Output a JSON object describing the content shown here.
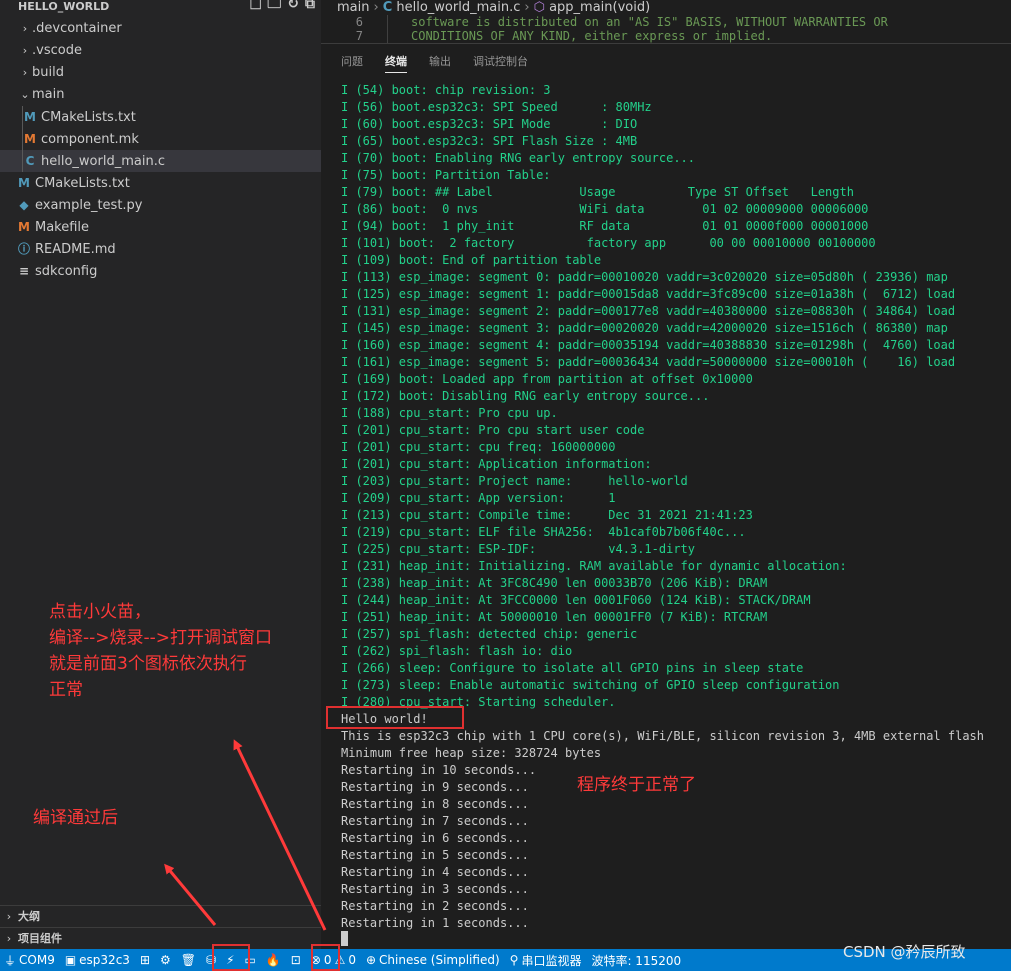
{
  "explorer": {
    "title": "HELLO_WORLD",
    "items": [
      {
        "type": "folder",
        "label": ".devcontainer",
        "expanded": false,
        "depth": 0
      },
      {
        "type": "folder",
        "label": ".vscode",
        "expanded": false,
        "depth": 0
      },
      {
        "type": "folder",
        "label": "build",
        "expanded": false,
        "depth": 0
      },
      {
        "type": "folder",
        "label": "main",
        "expanded": true,
        "depth": 0
      },
      {
        "type": "file",
        "label": "CMakeLists.txt",
        "icon": "M",
        "color": "#519aba",
        "depth": 1
      },
      {
        "type": "file",
        "label": "component.mk",
        "icon": "M",
        "color": "#e37933",
        "depth": 1
      },
      {
        "type": "file",
        "label": "hello_world_main.c",
        "icon": "C",
        "color": "#519aba",
        "depth": 1,
        "selected": true
      },
      {
        "type": "file",
        "label": "CMakeLists.txt",
        "icon": "M",
        "color": "#519aba",
        "depth": 0
      },
      {
        "type": "file",
        "label": "example_test.py",
        "icon": "◆",
        "color": "#519aba",
        "depth": 0
      },
      {
        "type": "file",
        "label": "Makefile",
        "icon": "M",
        "color": "#e37933",
        "depth": 0
      },
      {
        "type": "file",
        "label": "README.md",
        "icon": "ⓘ",
        "color": "#519aba",
        "depth": 0
      },
      {
        "type": "file",
        "label": "sdkconfig",
        "icon": "≡",
        "color": "#cccccc",
        "depth": 0
      }
    ],
    "outline": "大纲",
    "project_components": "项目组件"
  },
  "breadcrumb": {
    "folder": "main",
    "file": "hello_world_main.c",
    "symbol": "app_main(void)"
  },
  "code_lines": [
    {
      "num": "6",
      "text": "software is distributed on an \"AS IS\" BASIS, WITHOUT WARRANTIES OR"
    },
    {
      "num": "7",
      "text": "CONDITIONS OF ANY KIND, either express or implied."
    }
  ],
  "panel_tabs": [
    "问题",
    "终端",
    "输出",
    "调试控制台"
  ],
  "active_tab": "终端",
  "terminal": [
    {
      "c": "g",
      "t": "I (54) boot: chip revision: 3"
    },
    {
      "c": "g",
      "t": "I (56) boot.esp32c3: SPI Speed      : 80MHz"
    },
    {
      "c": "g",
      "t": "I (60) boot.esp32c3: SPI Mode       : DIO"
    },
    {
      "c": "g",
      "t": "I (65) boot.esp32c3: SPI Flash Size : 4MB"
    },
    {
      "c": "g",
      "t": "I (70) boot: Enabling RNG early entropy source..."
    },
    {
      "c": "g",
      "t": "I (75) boot: Partition Table:"
    },
    {
      "c": "g",
      "t": "I (79) boot: ## Label            Usage          Type ST Offset   Length"
    },
    {
      "c": "g",
      "t": "I (86) boot:  0 nvs              WiFi data        01 02 00009000 00006000"
    },
    {
      "c": "g",
      "t": "I (94) boot:  1 phy_init         RF data          01 01 0000f000 00001000"
    },
    {
      "c": "g",
      "t": "I (101) boot:  2 factory          factory app      00 00 00010000 00100000"
    },
    {
      "c": "g",
      "t": "I (109) boot: End of partition table"
    },
    {
      "c": "g",
      "t": "I (113) esp_image: segment 0: paddr=00010020 vaddr=3c020020 size=05d80h ( 23936) map"
    },
    {
      "c": "g",
      "t": "I (125) esp_image: segment 1: paddr=00015da8 vaddr=3fc89c00 size=01a38h (  6712) load"
    },
    {
      "c": "g",
      "t": "I (131) esp_image: segment 2: paddr=000177e8 vaddr=40380000 size=08830h ( 34864) load"
    },
    {
      "c": "g",
      "t": "I (145) esp_image: segment 3: paddr=00020020 vaddr=42000020 size=1516ch ( 86380) map"
    },
    {
      "c": "g",
      "t": "I (160) esp_image: segment 4: paddr=00035194 vaddr=40388830 size=01298h (  4760) load"
    },
    {
      "c": "g",
      "t": "I (161) esp_image: segment 5: paddr=00036434 vaddr=50000000 size=00010h (    16) load"
    },
    {
      "c": "g",
      "t": "I (169) boot: Loaded app from partition at offset 0x10000"
    },
    {
      "c": "g",
      "t": "I (172) boot: Disabling RNG early entropy source..."
    },
    {
      "c": "g",
      "t": "I (188) cpu_start: Pro cpu up."
    },
    {
      "c": "g",
      "t": "I (201) cpu_start: Pro cpu start user code"
    },
    {
      "c": "g",
      "t": "I (201) cpu_start: cpu freq: 160000000"
    },
    {
      "c": "g",
      "t": "I (201) cpu_start: Application information:"
    },
    {
      "c": "g",
      "t": "I (203) cpu_start: Project name:     hello-world"
    },
    {
      "c": "g",
      "t": "I (209) cpu_start: App version:      1"
    },
    {
      "c": "g",
      "t": "I (213) cpu_start: Compile time:     Dec 31 2021 21:41:23"
    },
    {
      "c": "g",
      "t": "I (219) cpu_start: ELF file SHA256:  4b1caf0b7b06f40c..."
    },
    {
      "c": "g",
      "t": "I (225) cpu_start: ESP-IDF:          v4.3.1-dirty"
    },
    {
      "c": "g",
      "t": "I (231) heap_init: Initializing. RAM available for dynamic allocation:"
    },
    {
      "c": "g",
      "t": "I (238) heap_init: At 3FC8C490 len 00033B70 (206 KiB): DRAM"
    },
    {
      "c": "g",
      "t": "I (244) heap_init: At 3FCC0000 len 0001F060 (124 KiB): STACK/DRAM"
    },
    {
      "c": "g",
      "t": "I (251) heap_init: At 50000010 len 00001FF0 (7 KiB): RTCRAM"
    },
    {
      "c": "g",
      "t": "I (257) spi_flash: detected chip: generic"
    },
    {
      "c": "g",
      "t": "I (262) spi_flash: flash io: dio"
    },
    {
      "c": "g",
      "t": "I (266) sleep: Configure to isolate all GPIO pins in sleep state"
    },
    {
      "c": "g",
      "t": "I (273) sleep: Enable automatic switching of GPIO sleep configuration"
    },
    {
      "c": "g",
      "t": "I (280) cpu_start: Starting scheduler."
    },
    {
      "c": "w",
      "t": "Hello world!"
    },
    {
      "c": "w",
      "t": "This is esp32c3 chip with 1 CPU core(s), WiFi/BLE, silicon revision 3, 4MB external flash"
    },
    {
      "c": "w",
      "t": "Minimum free heap size: 328724 bytes"
    },
    {
      "c": "w",
      "t": "Restarting in 10 seconds..."
    },
    {
      "c": "w",
      "t": "Restarting in 9 seconds..."
    },
    {
      "c": "w",
      "t": "Restarting in 8 seconds..."
    },
    {
      "c": "w",
      "t": "Restarting in 7 seconds..."
    },
    {
      "c": "w",
      "t": "Restarting in 6 seconds..."
    },
    {
      "c": "w",
      "t": "Restarting in 5 seconds..."
    },
    {
      "c": "w",
      "t": "Restarting in 4 seconds..."
    },
    {
      "c": "w",
      "t": "Restarting in 3 seconds..."
    },
    {
      "c": "w",
      "t": "Restarting in 2 seconds..."
    },
    {
      "c": "w",
      "t": "Restarting in 1 seconds..."
    }
  ],
  "statusbar": {
    "port": "COM9",
    "target": "esp32c3",
    "errors": "0",
    "warnings": "0",
    "language": "Chinese (Simplified)",
    "serial_monitor": "串口监视器",
    "baud": "波特率: 115200"
  },
  "annotations": {
    "note1_line1": "点击小火苗，",
    "note1_line2": "编译-->烧录-->打开调试窗口",
    "note1_line3": "就是前面3个图标依次执行",
    "note1_line4": "正常",
    "note2": "编译通过后",
    "note3": "程序终于正常了",
    "color": "#ff3a3a"
  },
  "watermark": "CSDN @矜辰所致"
}
